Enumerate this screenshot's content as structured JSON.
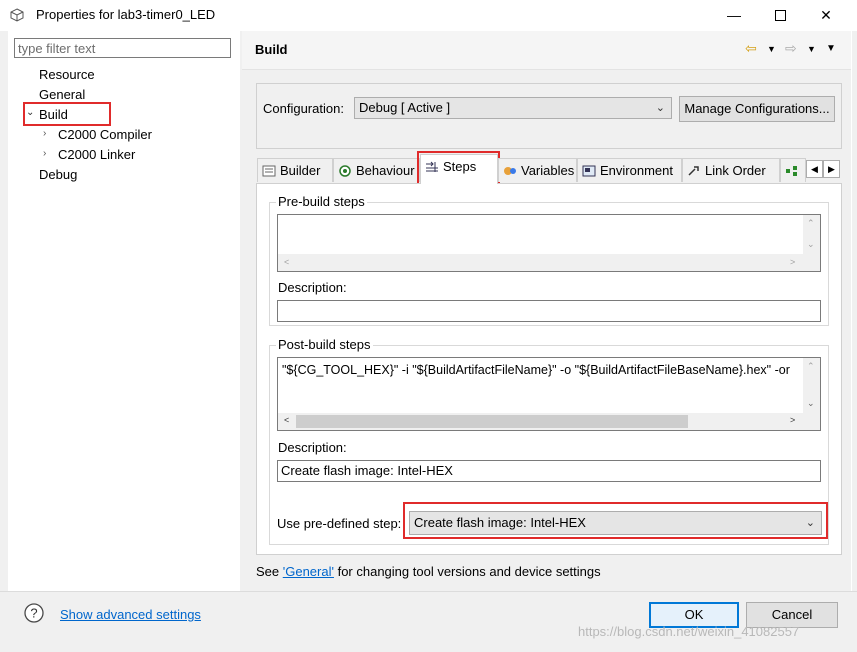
{
  "window": {
    "title": "Properties for lab3-timer0_LED"
  },
  "filter": {
    "placeholder": "type filter text"
  },
  "tree": {
    "resource": "Resource",
    "general": "General",
    "build": "Build",
    "compiler": "C2000 Compiler",
    "linker": "C2000 Linker",
    "debug": "Debug"
  },
  "header": {
    "title": "Build"
  },
  "configuration": {
    "label": "Configuration:",
    "value": "Debug  [ Active ]",
    "manage_label": "Manage Configurations..."
  },
  "tabs": [
    "Builder",
    "Behaviour",
    "Steps",
    "Variables",
    "Environment",
    "Link Order"
  ],
  "prebuild": {
    "title": "Pre-build steps",
    "command": "",
    "description_label": "Description:",
    "description": ""
  },
  "postbuild": {
    "title": "Post-build steps",
    "command": "\"${CG_TOOL_HEX}\" -i \"${BuildArtifactFileName}\" -o \"${BuildArtifactFileBaseName}.hex\" -or",
    "description_label": "Description:",
    "description": "Create flash image: Intel-HEX",
    "predefined_label": "Use pre-defined step:",
    "predefined_value": "Create flash image: Intel-HEX"
  },
  "see": {
    "prefix": "See ",
    "link": "'General'",
    "suffix": " for changing tool versions and device settings"
  },
  "footer": {
    "advanced_label": "Show advanced settings",
    "ok_label": "OK",
    "cancel_label": "Cancel",
    "watermark": "https://blog.csdn.net/weixin_41082557"
  },
  "colors": {
    "highlight_red": "#e02b2b",
    "link_blue": "#0066cc",
    "primary_border": "#0078d7"
  }
}
